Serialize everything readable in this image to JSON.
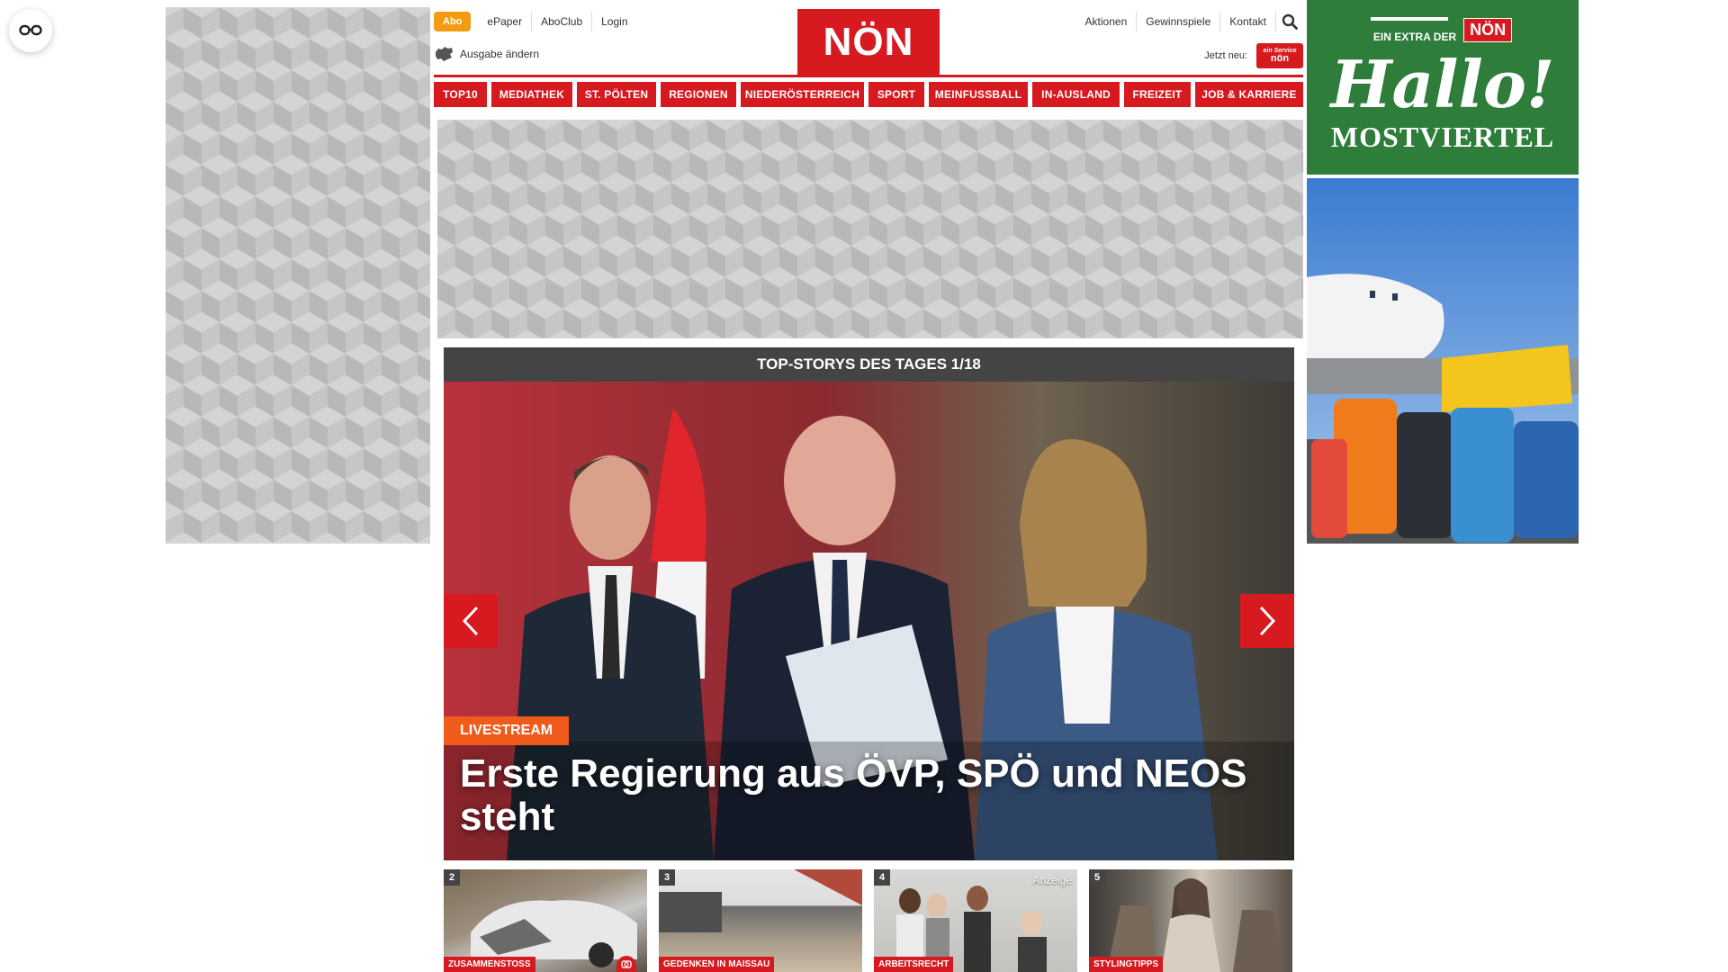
{
  "header": {
    "abo_label": "Abo",
    "links_left": [
      "ePaper",
      "AboClub",
      "Login"
    ],
    "ausgabe_label": "Ausgabe ändern",
    "logo_text": "NÖN",
    "links_right": [
      "Aktionen",
      "Gewinnspiele",
      "Kontakt"
    ],
    "jetzt_neu_label": "Jetzt neu:",
    "jetzt_neu_logo_top": "ein Service",
    "jetzt_neu_logo": "nön"
  },
  "nav": {
    "items": [
      "TOP10",
      "MEDIATHEK",
      "ST. PÖLTEN",
      "REGIONEN",
      "NIEDERÖSTERREICH",
      "SPORT",
      "MEINFUSSBALL",
      "IN-AUSLAND",
      "FREIZEIT",
      "JOB & KARRIERE"
    ]
  },
  "slider": {
    "heading": "TOP-STORYS DES TAGES 1/18",
    "tag": "LIVESTREAM",
    "title": "Erste Regierung aus ÖVP, SPÖ und NEOS steht"
  },
  "thumbs": [
    {
      "num": "2",
      "tag": "ZUSAMMENSTOSS",
      "anzeige": ""
    },
    {
      "num": "3",
      "tag": "GEDENKEN IN MAISSAU",
      "anzeige": ""
    },
    {
      "num": "4",
      "tag": "ARBEITSRECHT",
      "anzeige": "Anzeige"
    },
    {
      "num": "5",
      "tag": "STYLINGTIPPS",
      "anzeige": ""
    }
  ],
  "right_ad": {
    "strip_text": "EIN EXTRA DER",
    "strip_logo": "NÖN",
    "headline": "Hallo!",
    "subline": "MOSTVIERTEL"
  },
  "colors": {
    "brand_red": "#d71920",
    "abo_orange": "#f39c12",
    "livestream_orange": "#f05a1a",
    "ad_green": "#2e7d3a"
  },
  "icons": {
    "a11y": "glasses-icon",
    "search": "search-icon",
    "region": "map-icon",
    "prev": "chevron-left-icon",
    "next": "chevron-right-icon",
    "camera": "camera-icon"
  }
}
